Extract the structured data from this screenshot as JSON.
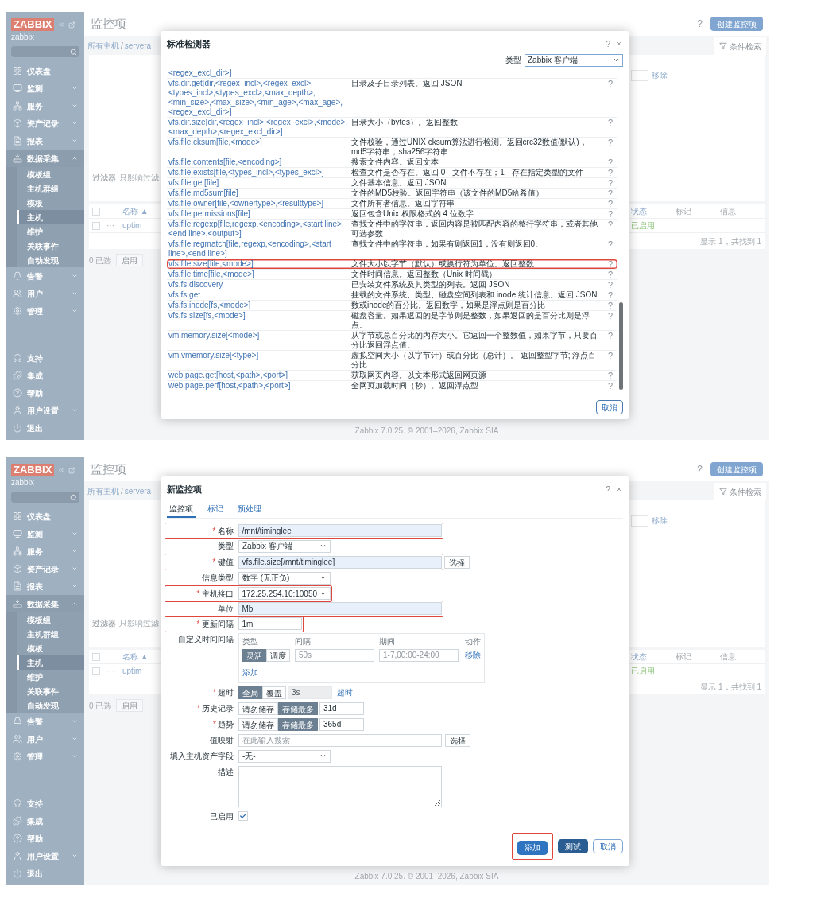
{
  "screens": [
    {
      "sidebar": {
        "logo": "ZABBIX",
        "server": "zabbix",
        "menu": [
          {
            "kind": "link",
            "label": "仪表盘"
          },
          {
            "kind": "group",
            "label": "监测",
            "expanded": false
          },
          {
            "kind": "group",
            "label": "服务",
            "expanded": false
          },
          {
            "kind": "group",
            "label": "资产记录",
            "expanded": false
          },
          {
            "kind": "group",
            "label": "报表",
            "expanded": false
          },
          {
            "kind": "group",
            "label": "数据采集",
            "expanded": true,
            "children": [
              {
                "label": "模板组",
                "selected": false
              },
              {
                "label": "主机群组",
                "selected": false
              },
              {
                "label": "模板",
                "selected": false
              },
              {
                "label": "主机",
                "selected": true
              },
              {
                "label": "维护",
                "selected": false
              },
              {
                "label": "关联事件",
                "selected": false
              },
              {
                "label": "自动发现",
                "selected": false
              }
            ]
          },
          {
            "kind": "group",
            "label": "告警",
            "expanded": false
          },
          {
            "kind": "group",
            "label": "用户",
            "expanded": false
          },
          {
            "kind": "group",
            "label": "管理",
            "expanded": false
          }
        ],
        "bottom_menu": [
          {
            "kind": "link",
            "label": "支持"
          },
          {
            "kind": "link",
            "label": "集成"
          },
          {
            "kind": "link",
            "label": "帮助"
          },
          {
            "kind": "group",
            "label": "用户设置",
            "expanded": false
          },
          {
            "kind": "link",
            "label": "退出"
          }
        ]
      },
      "page": {
        "title": "监控项",
        "help": "?",
        "create_button": "创建监控项",
        "breadcrumb": [
          "所有主机",
          "servera"
        ],
        "breadcrumb_separator": "/",
        "filter_tab": "条件检索",
        "filter_remove": "移除",
        "filter_label": "过滤器",
        "filter_hint": "只影响过滤",
        "table": {
          "all_checked": false,
          "name_column": "名称 ▲",
          "columns": [
            "状态",
            "标记",
            "信息"
          ],
          "row": {
            "checked": false,
            "menu": "···",
            "name": "uptim",
            "status": "已启用"
          },
          "summary": "显示 1，共找到 1"
        },
        "selected_count": "0 已选",
        "actions": [
          "启用"
        ],
        "footer": "Zabbix 7.0.25. © 2001–2026, Zabbix SIA"
      },
      "dialog": {
        "kind": "key_picker",
        "title": "标准检测器",
        "help": "?",
        "type_label": "类型",
        "type_value": "Zabbix 客户端",
        "cancel": "取消",
        "rows": [
          {
            "key": "<regex_excl_dir>]",
            "highlighted": false
          },
          {
            "key": "vfs.dir.get[dir,<regex_incl>,<regex_excl>,<types_incl>,<types_excl>,<max_depth>,<min_size>,<max_size>,<min_age>,<max_age>,<regex_excl_dir>]",
            "description": "目录及子目录列表。返回 JSON",
            "help": "?",
            "highlighted": false
          },
          {
            "key": "vfs.dir.size[dir,<regex_incl>,<regex_excl>,<mode>,<max_depth>,<regex_excl_dir>]",
            "description": "目录大小（bytes）。返回整数",
            "help": "?",
            "highlighted": false
          },
          {
            "key": "vfs.file.cksum[file,<mode>]",
            "description": "文件校验，通过UNIX cksum算法进行检测。返回crc32数值(默认)，md5字符串，sha256字符串",
            "help": "?",
            "highlighted": false
          },
          {
            "key": "vfs.file.contents[file,<encoding>]",
            "description": "搜索文件内容。返回文本",
            "help": "?",
            "highlighted": false
          },
          {
            "key": "vfs.file.exists[file,<types_incl>,<types_excl>]",
            "description": "检查文件是否存在。返回 0 - 文件不存在；1 - 存在指定类型的文件",
            "help": "?",
            "highlighted": false
          },
          {
            "key": "vfs.file.get[file]",
            "description": "文件基本信息。返回 JSON",
            "help": "?",
            "highlighted": false
          },
          {
            "key": "vfs.file.md5sum[file]",
            "description": "文件的MD5校验。返回字符串（该文件的MD5哈希值）",
            "help": "?",
            "highlighted": false
          },
          {
            "key": "vfs.file.owner[file,<ownertype>,<resulttype>]",
            "description": "文件所有者信息。返回字符串",
            "help": "?",
            "highlighted": false
          },
          {
            "key": "vfs.file.permissions[file]",
            "description": "返回包含Unix 权限格式的 4 位数字",
            "help": "?",
            "highlighted": false
          },
          {
            "key": "vfs.file.regexp[file,regexp,<encoding>,<start line>,<end line>,<output>]",
            "description": "查找文件中的字符串，返回内容是被匹配内容的整行字符串，或者其他可选参数",
            "help": "?",
            "highlighted": false
          },
          {
            "key": "vfs.file.regmatch[file,regexp,<encoding>,<start line>,<end line>]",
            "description": "查找文件中的字符串，如果有则返回1，没有则返回0。",
            "help": "?",
            "highlighted": false
          },
          {
            "key": "vfs.file.size[file,<mode>]",
            "description": "文件大小以字节（默认）或换行符为单位。返回整数",
            "help": "?",
            "highlighted": true
          },
          {
            "key": "vfs.file.time[file,<mode>]",
            "description": "文件时间信息。返回整数（Unix 时间戳）",
            "help": "?",
            "highlighted": false
          },
          {
            "key": "vfs.fs.discovery",
            "description": "已安装文件系统及其类型的列表。返回 JSON",
            "help": "?",
            "highlighted": false
          },
          {
            "key": "vfs.fs.get",
            "description": "挂载的文件系统、类型、磁盘空间列表和 inode 统计信息。返回 JSON",
            "help": "?",
            "highlighted": false
          },
          {
            "key": "vfs.fs.inode[fs,<mode>]",
            "description": "数或inode的百分比。返回数字，如果是浮点则是百分比",
            "help": "?",
            "highlighted": false
          },
          {
            "key": "vfs.fs.size[fs,<mode>]",
            "description": "磁盘容量。如果返回的是字节则是整数，如果返回的是百分比则是浮点。",
            "help": "?",
            "highlighted": false
          },
          {
            "key": "vm.memory.size[<mode>]",
            "description": "从字节或总百分比的内存大小。它返回一个整数值，如果字节，只要百分比返回浮点值。",
            "help": "?",
            "highlighted": false
          },
          {
            "key": "vm.vmemory.size[<type>]",
            "description": "虚拟空间大小（以字节计）或百分比（总计）。 返回整型字节; 浮点百分比",
            "help": "?",
            "highlighted": false
          },
          {
            "key": "web.page.get[host,<path>,<port>]",
            "description": "获取网页内容。以文本形式返回网页源",
            "help": "?",
            "highlighted": false
          },
          {
            "key": "web.page.perf[host,<path>,<port>]",
            "description": "全网页加载时间（秒）。返回浮点型",
            "help": "?",
            "highlighted": false
          }
        ]
      }
    },
    {
      "sidebar": {
        "logo": "ZABBIX",
        "server": "zabbix",
        "menu": [
          {
            "kind": "link",
            "label": "仪表盘"
          },
          {
            "kind": "group",
            "label": "监测",
            "expanded": false
          },
          {
            "kind": "group",
            "label": "服务",
            "expanded": false
          },
          {
            "kind": "group",
            "label": "资产记录",
            "expanded": false
          },
          {
            "kind": "group",
            "label": "报表",
            "expanded": false
          },
          {
            "kind": "group",
            "label": "数据采集",
            "expanded": true,
            "children": [
              {
                "label": "模板组",
                "selected": false
              },
              {
                "label": "主机群组",
                "selected": false
              },
              {
                "label": "模板",
                "selected": false
              },
              {
                "label": "主机",
                "selected": true
              },
              {
                "label": "维护",
                "selected": false
              },
              {
                "label": "关联事件",
                "selected": false
              },
              {
                "label": "自动发现",
                "selected": false
              }
            ]
          },
          {
            "kind": "group",
            "label": "告警",
            "expanded": false
          },
          {
            "kind": "group",
            "label": "用户",
            "expanded": false
          },
          {
            "kind": "group",
            "label": "管理",
            "expanded": false
          }
        ],
        "bottom_menu": [
          {
            "kind": "link",
            "label": "支持"
          },
          {
            "kind": "link",
            "label": "集成"
          },
          {
            "kind": "link",
            "label": "帮助"
          },
          {
            "kind": "group",
            "label": "用户设置",
            "expanded": false
          },
          {
            "kind": "link",
            "label": "退出"
          }
        ]
      },
      "page": {
        "title": "监控项",
        "help": "?",
        "create_button": "创建监控项",
        "breadcrumb": [
          "所有主机",
          "servera"
        ],
        "breadcrumb_separator": "/",
        "filter_tab": "条件检索",
        "filter_remove": "移除",
        "filter_label": "过滤器",
        "filter_hint": "只影响过滤",
        "table": {
          "all_checked": false,
          "name_column": "名称 ▲",
          "columns": [
            "状态",
            "标记",
            "信息"
          ],
          "row": {
            "checked": false,
            "menu": "···",
            "name": "uptim",
            "status": "已启用"
          },
          "summary": "显示 1，共找到 1"
        },
        "selected_count": "0 已选",
        "actions": [
          "启用"
        ],
        "footer": "Zabbix 7.0.25. © 2001–2026, Zabbix SIA"
      },
      "dialog": {
        "kind": "item_form",
        "title": "新监控项",
        "help": "?",
        "required_mark": "*",
        "tabs": [
          {
            "label": "监控项",
            "selected": true
          },
          {
            "label": "标记",
            "selected": false
          },
          {
            "label": "预处理",
            "selected": false
          }
        ],
        "fields": [
          {
            "kind": "text",
            "label": "名称",
            "required": true,
            "highlighted": true,
            "value": "/mnt/timinglee",
            "autofilled": true
          },
          {
            "kind": "select",
            "label": "类型",
            "required": false,
            "highlighted": false,
            "value": "Zabbix 客户端"
          },
          {
            "kind": "text_button",
            "label": "键值",
            "required": true,
            "highlighted": true,
            "value": "vfs.file.size[/mnt/timinglee]",
            "autofilled": true,
            "button": "选择"
          },
          {
            "kind": "select",
            "label": "信息类型",
            "required": false,
            "highlighted": false,
            "value": "数字 (无正负)"
          },
          {
            "kind": "select",
            "label": "主机接口",
            "required": true,
            "highlighted": true,
            "value": "172.25.254.10:10050"
          },
          {
            "kind": "text",
            "label": "单位",
            "required": false,
            "highlighted": true,
            "value": "Mb",
            "autofilled": true
          },
          {
            "kind": "short_text",
            "label": "更新间隔",
            "required": true,
            "highlighted": true,
            "value": "1m",
            "autofilled": false
          },
          {
            "kind": "intervals",
            "label": "自定义时间间隔",
            "required": false,
            "highlighted": false,
            "columns": [
              "类型",
              "间隔",
              "期间",
              "动作"
            ],
            "rows": [
              {
                "options": [
                  {
                    "label": "灵活",
                    "selected": true
                  },
                  {
                    "label": "调度",
                    "selected": false
                  }
                ],
                "interval_placeholder": "50s",
                "period_placeholder": "1-7,00:00-24:00",
                "remove": "移除"
              }
            ],
            "add": "添加"
          },
          {
            "kind": "segmented",
            "label": "超时",
            "required": true,
            "highlighted": false,
            "options": [
              {
                "label": "全局",
                "selected": true
              },
              {
                "label": "覆盖",
                "selected": false
              }
            ],
            "value": "3s",
            "disabled": true,
            "link": "超时"
          },
          {
            "kind": "segmented",
            "label": "历史记录",
            "required": true,
            "highlighted": false,
            "options": [
              {
                "label": "请勿储存",
                "selected": false
              },
              {
                "label": "存储最多",
                "selected": true
              }
            ],
            "value": "31d",
            "disabled": false
          },
          {
            "kind": "segmented",
            "label": "趋势",
            "required": true,
            "highlighted": false,
            "options": [
              {
                "label": "请勿储存",
                "selected": false
              },
              {
                "label": "存储最多",
                "selected": true
              }
            ],
            "value": "365d",
            "disabled": false
          },
          {
            "kind": "text_button",
            "label": "值映射",
            "required": false,
            "highlighted": false,
            "placeholder": "在此输入搜索",
            "autofilled": false,
            "button": "选择"
          },
          {
            "kind": "select",
            "label": "填入主机资产字段",
            "required": false,
            "highlighted": false,
            "value": "-无-"
          },
          {
            "kind": "textarea",
            "label": "描述",
            "required": false,
            "highlighted": false
          },
          {
            "kind": "checkbox",
            "label": "已启用",
            "required": false,
            "highlighted": false,
            "checked": true
          }
        ],
        "buttons": [
          {
            "label": "添加",
            "kind": "primary",
            "highlighted": true
          },
          {
            "label": "测试",
            "kind": "secondary",
            "highlighted": false
          },
          {
            "label": "取消",
            "kind": "outline",
            "highlighted": false
          }
        ]
      }
    }
  ]
}
